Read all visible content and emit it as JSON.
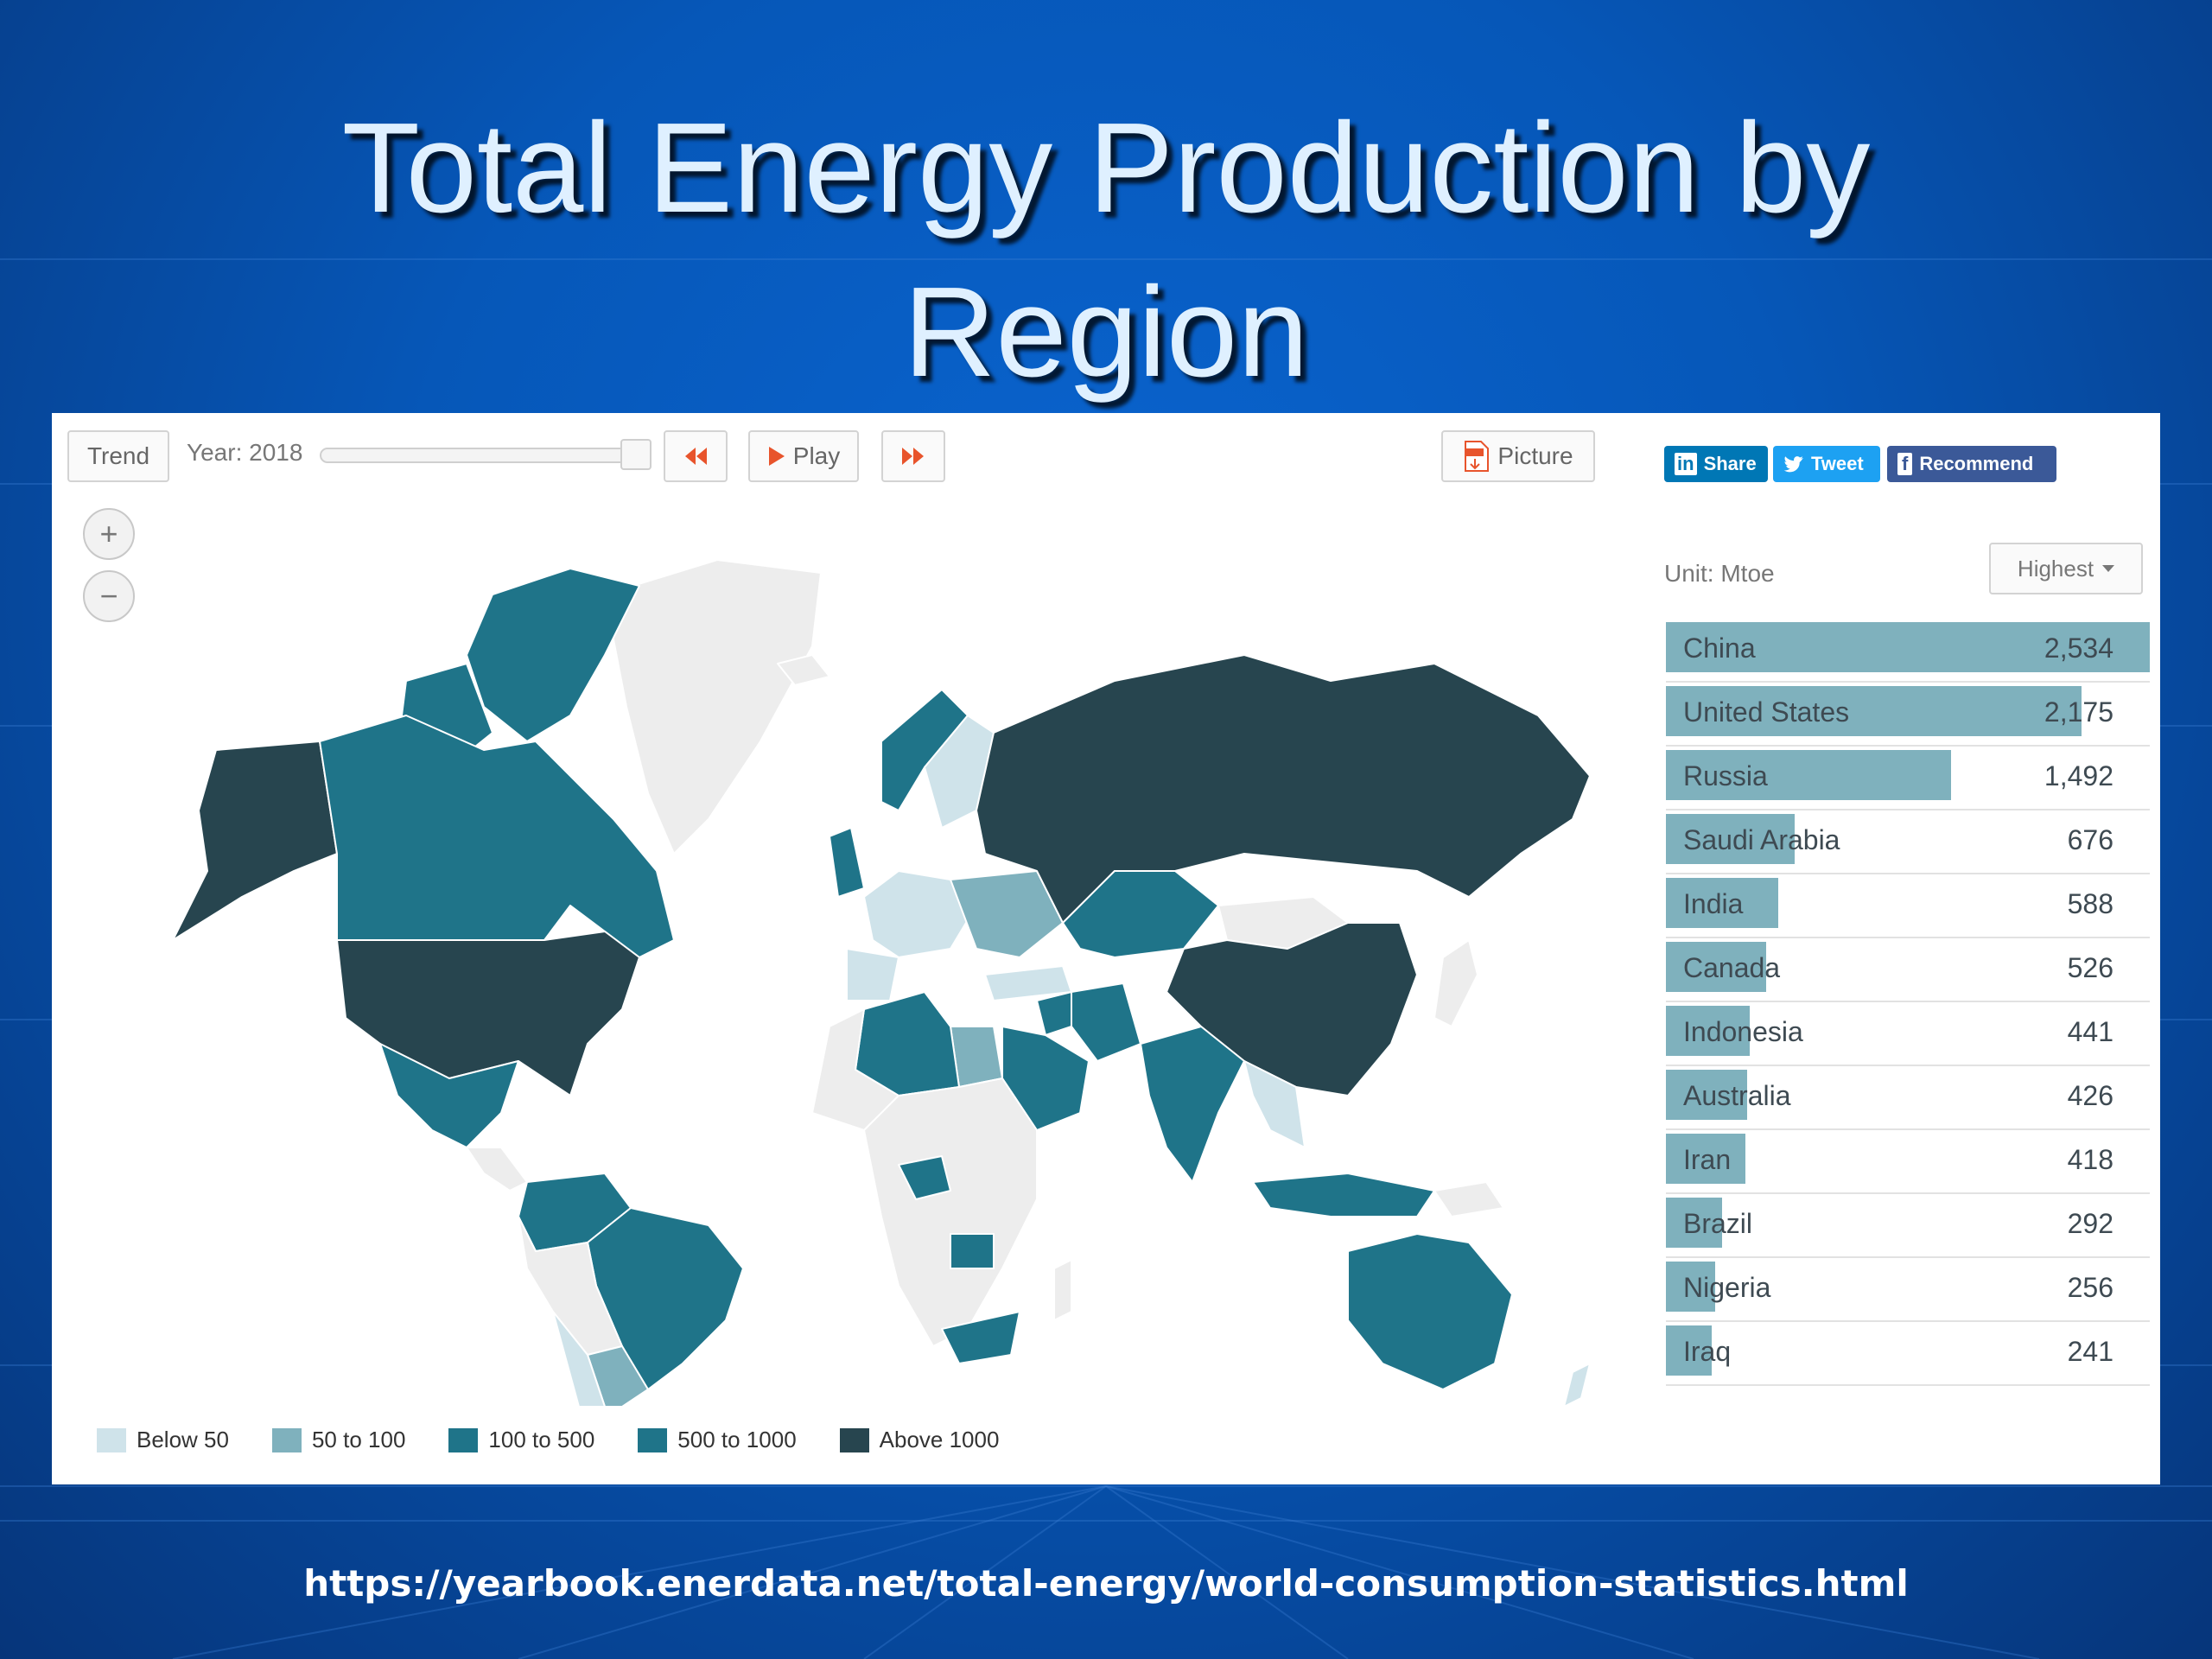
{
  "slide": {
    "title_line1": "Total Energy Production by",
    "title_line2": "Region",
    "source_url": "https://yearbook.enerdata.net/total-energy/world-consumption-statistics.html"
  },
  "toolbar": {
    "trend_label": "Trend",
    "year_label": "Year: 2018",
    "year_position": 1.0,
    "play_label": "Play",
    "picture_label": "Picture",
    "picture_icon": "png-file-icon",
    "rewind_icon": "rewind-icon",
    "play_icon": "play-icon",
    "forward_icon": "fast-forward-icon"
  },
  "zoom": {
    "in_label": "+",
    "out_label": "−"
  },
  "share": {
    "linkedin_label": "Share",
    "twitter_label": "Tweet",
    "facebook_label": "Recommend",
    "linkedin_color": "#0077b5",
    "twitter_color": "#1da1f2",
    "facebook_color": "#3b5998"
  },
  "ranking": {
    "unit_label": "Unit: Mtoe",
    "sort_label": "Highest",
    "max_value": 2534,
    "bar_color": "#7fb1bd",
    "rows": [
      {
        "name": "China",
        "value": 2534,
        "display": "2,534"
      },
      {
        "name": "United States",
        "value": 2175,
        "display": "2,175"
      },
      {
        "name": "Russia",
        "value": 1492,
        "display": "1,492"
      },
      {
        "name": "Saudi Arabia",
        "value": 676,
        "display": "676"
      },
      {
        "name": "India",
        "value": 588,
        "display": "588"
      },
      {
        "name": "Canada",
        "value": 526,
        "display": "526"
      },
      {
        "name": "Indonesia",
        "value": 441,
        "display": "441"
      },
      {
        "name": "Australia",
        "value": 426,
        "display": "426"
      },
      {
        "name": "Iran",
        "value": 418,
        "display": "418"
      },
      {
        "name": "Brazil",
        "value": 292,
        "display": "292"
      },
      {
        "name": "Nigeria",
        "value": 256,
        "display": "256"
      },
      {
        "name": "Iraq",
        "value": 241,
        "display": "241"
      }
    ]
  },
  "legend": [
    {
      "label": "Below 50",
      "color": "#cfe3ea"
    },
    {
      "label": "50 to 100",
      "color": "#7fb1bd"
    },
    {
      "label": "100 to 500",
      "color": "#1f7489"
    },
    {
      "label": "500 to 1000",
      "color": "#1f7489"
    },
    {
      "label": "Above 1000",
      "color": "#27454f"
    }
  ],
  "map_colors": {
    "no_data": "#ededed",
    "below_50": "#cfe3ea",
    "50_100": "#7fb1bd",
    "100_500": "#1f7489",
    "above_1000": "#27454f"
  }
}
